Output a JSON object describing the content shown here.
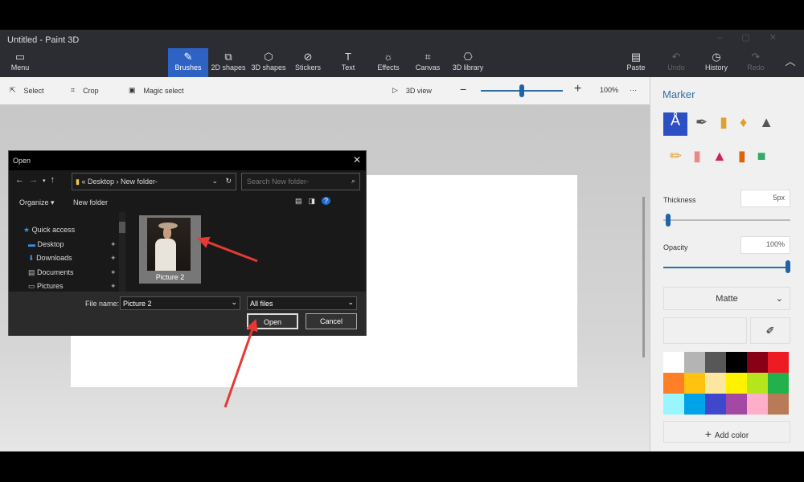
{
  "window": {
    "title": "Untitled - Paint 3D"
  },
  "toolbar": {
    "menu": "Menu",
    "tabs": [
      {
        "label": "Brushes",
        "icon": "brush-icon"
      },
      {
        "label": "2D shapes",
        "icon": "2d-shapes-icon"
      },
      {
        "label": "3D shapes",
        "icon": "cube-icon"
      },
      {
        "label": "Stickers",
        "icon": "sticker-icon"
      },
      {
        "label": "Text",
        "icon": "text-icon"
      },
      {
        "label": "Effects",
        "icon": "sun-icon"
      },
      {
        "label": "Canvas",
        "icon": "canvas-icon"
      },
      {
        "label": "3D library",
        "icon": "3d-library-icon"
      }
    ],
    "paste": "Paste",
    "undo": "Undo",
    "history": "History",
    "redo": "Redo",
    "active_color": "#2e63c4"
  },
  "subbar": {
    "select": "Select",
    "crop": "Crop",
    "magic_select": "Magic select",
    "view3d": "3D view",
    "zoom": "100%",
    "zoom_slider": 0.5
  },
  "panel": {
    "title": "Marker",
    "thickness_label": "Thickness",
    "thickness": "5px",
    "thickness_slider": 0.02,
    "opacity_label": "Opacity",
    "opacity": "100%",
    "opacity_slider": 1.0,
    "finish": "Matte",
    "add_color": "Add color",
    "palette": [
      "#ffffff",
      "#b4b4b4",
      "#575757",
      "#000000",
      "#880015",
      "#ed1c24",
      "#ff7f27",
      "#ffc20e",
      "#fde6a0",
      "#fff200",
      "#b5e61d",
      "#22b14c",
      "#99f5ff",
      "#00a2e8",
      "#3f48cc",
      "#a349a4",
      "#ffaec9",
      "#b97a57"
    ]
  },
  "dialog": {
    "title": "Open",
    "path": [
      "Desktop",
      "New folder-"
    ],
    "search_placeholder": "Search New folder-",
    "organize": "Organize",
    "new_folder": "New folder",
    "nav": [
      "Quick access",
      "Desktop",
      "Downloads",
      "Documents",
      "Pictures"
    ],
    "file": "Picture 2",
    "file_name_label": "File name:",
    "file_name": "Picture 2",
    "file_type": "All files",
    "open": "Open",
    "cancel": "Cancel"
  },
  "annotation_color": "#e53935"
}
